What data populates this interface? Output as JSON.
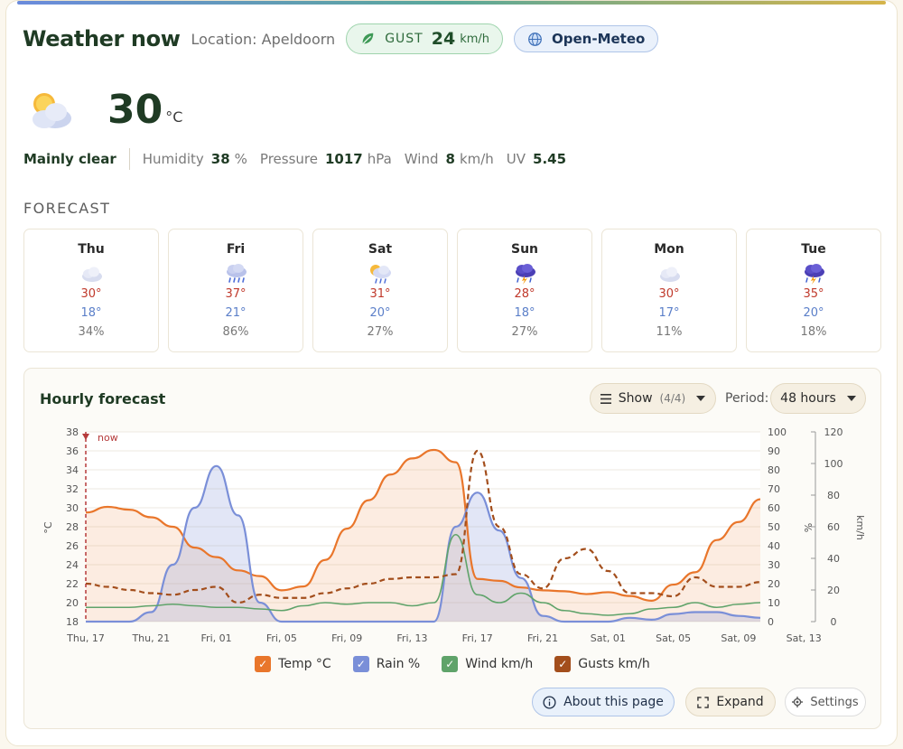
{
  "header": {
    "title": "Weather now",
    "location": "Location: Apeldoorn",
    "gust_label": "GUST",
    "gust_value": "24",
    "gust_unit": "km/h",
    "source": "Open-Meteo"
  },
  "current": {
    "icon": "partly-cloudy-icon",
    "temp": "30",
    "unit": "°C",
    "condition": "Mainly clear",
    "humidity_label": "Humidity",
    "humidity_value": "38",
    "humidity_unit": "%",
    "pressure_label": "Pressure",
    "pressure_value": "1017",
    "pressure_unit": "hPa",
    "wind_label": "Wind",
    "wind_value": "8",
    "wind_unit": "km/h",
    "uv_label": "UV",
    "uv_value": "5.45"
  },
  "forecast": {
    "title": "FORECAST",
    "days": [
      {
        "name": "Thu",
        "icon": "cloud-icon",
        "hi": "30°",
        "lo": "18°",
        "precip": "34%"
      },
      {
        "name": "Fri",
        "icon": "rain-cloud-icon",
        "hi": "37°",
        "lo": "21°",
        "precip": "86%"
      },
      {
        "name": "Sat",
        "icon": "sun-rain-cloud-icon",
        "hi": "31°",
        "lo": "20°",
        "precip": "27%"
      },
      {
        "name": "Sun",
        "icon": "thunderstorm-icon",
        "hi": "28°",
        "lo": "18°",
        "precip": "27%"
      },
      {
        "name": "Mon",
        "icon": "cloud-icon",
        "hi": "30°",
        "lo": "17°",
        "precip": "11%"
      },
      {
        "name": "Tue",
        "icon": "thunderstorm-icon",
        "hi": "35°",
        "lo": "20°",
        "precip": "18%"
      }
    ]
  },
  "hourly": {
    "title": "Hourly forecast",
    "show_label": "Show",
    "show_count": "(4/4)",
    "period_label": "Period:",
    "period_value": "48 hours",
    "about_label": "About this page",
    "expand_label": "Expand",
    "settings_label": "Settings"
  },
  "colors": {
    "temp": "#e9762b",
    "rain": "#7a8fd8",
    "wind": "#5fa36a",
    "gusts": "#a34e1c"
  },
  "chart_data": {
    "type": "area",
    "now_label": "now",
    "x": [
      "Thu, 17",
      "Thu, 21",
      "Fri, 01",
      "Fri, 05",
      "Fri, 09",
      "Fri, 13",
      "Fri, 17",
      "Fri, 21",
      "Sat, 01",
      "Sat, 05",
      "Sat, 09",
      "Sat, 13"
    ],
    "hours_per_step": 2,
    "y_left": {
      "label": "°C",
      "ylim": [
        18,
        38
      ],
      "ticks": [
        18,
        20,
        22,
        24,
        26,
        28,
        30,
        32,
        34,
        36,
        38
      ]
    },
    "y_right_pct": {
      "label": "%",
      "ylim": [
        0,
        100
      ],
      "ticks": [
        0,
        10,
        20,
        30,
        40,
        50,
        60,
        70,
        80,
        90,
        100
      ]
    },
    "y_right_kmh": {
      "label": "km/h",
      "ylim": [
        0,
        120
      ],
      "ticks": [
        0,
        20,
        40,
        60,
        80,
        100,
        120
      ]
    },
    "series": [
      {
        "name": "Temp °C",
        "axis": "left",
        "values": [
          29.5,
          30.1,
          29.8,
          29.0,
          28.0,
          25.8,
          24.8,
          23.4,
          22.8,
          21.3,
          21.7,
          24.5,
          27.8,
          30.8,
          33.5,
          35.2,
          36.1,
          34.8,
          22.5,
          22.3,
          21.6,
          21.3,
          21.2,
          20.9,
          21.1,
          20.7,
          20.2,
          21.9,
          23.2,
          26.6,
          28.5,
          30.9
        ]
      },
      {
        "name": "Rain %",
        "axis": "pct",
        "values": [
          0,
          0,
          0,
          5,
          30,
          60,
          82,
          56,
          10,
          0,
          0,
          0,
          0,
          0,
          0,
          0,
          0,
          50,
          68,
          48,
          23,
          3,
          0,
          0,
          0,
          2,
          1,
          4,
          5,
          5,
          3,
          2
        ]
      },
      {
        "name": "Wind km/h",
        "axis": "kmh",
        "values": [
          9,
          9,
          9,
          10,
          11,
          10,
          9,
          9,
          8,
          7,
          10,
          12,
          11,
          12,
          12,
          10,
          12,
          55,
          17,
          12,
          18,
          12,
          7,
          5,
          4,
          5,
          8,
          9,
          12,
          9,
          11,
          12
        ]
      },
      {
        "name": "Gusts km/h",
        "axis": "kmh",
        "values": [
          24,
          22,
          20,
          18,
          17,
          20,
          22,
          12,
          17,
          15,
          15,
          18,
          21,
          24,
          27,
          28,
          28,
          30,
          108,
          60,
          30,
          21,
          40,
          46,
          32,
          18,
          18,
          16,
          28,
          22,
          22,
          25
        ]
      }
    ]
  }
}
